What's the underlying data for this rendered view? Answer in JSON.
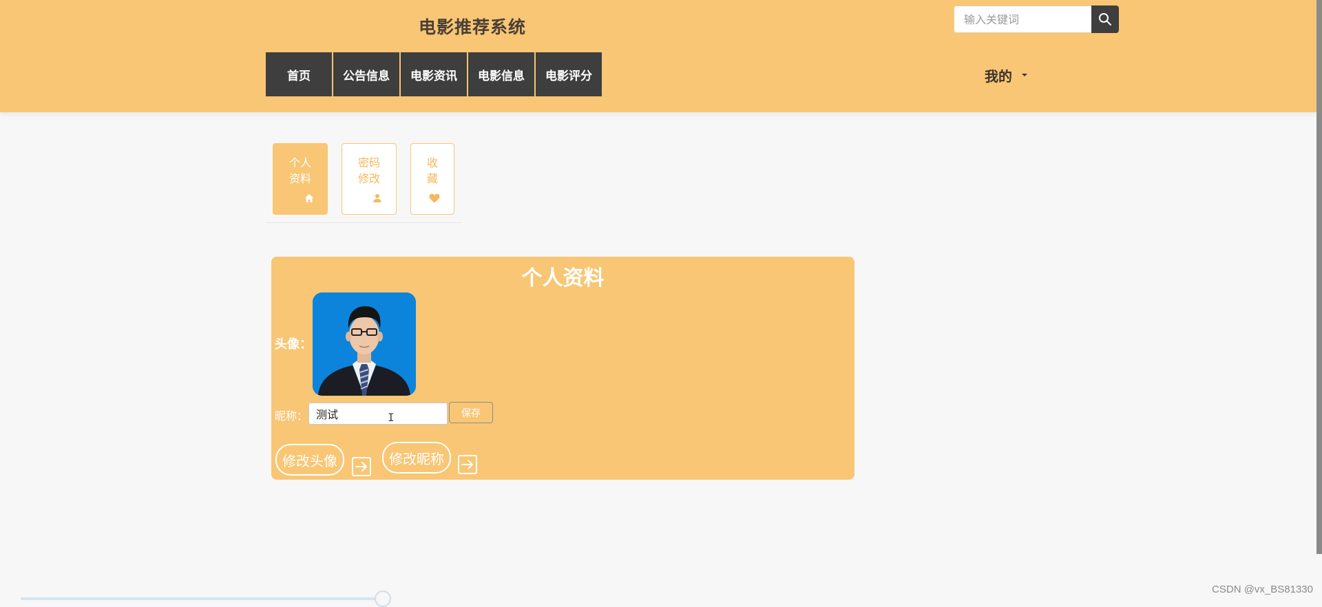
{
  "header": {
    "title": "电影推荐系统",
    "search": {
      "placeholder": "输入关键词",
      "icon": "search-icon"
    },
    "nav": [
      {
        "label": "首页"
      },
      {
        "label": "公告信息"
      },
      {
        "label": "电影资讯"
      },
      {
        "label": "电影信息"
      },
      {
        "label": "电影评分"
      }
    ],
    "user_menu": {
      "label": "我的",
      "icon": "caret-down-icon"
    }
  },
  "tabs": [
    {
      "label": "个人\n资料",
      "icon": "home-icon",
      "active": true
    },
    {
      "label": "密码\n修改",
      "icon": "user-icon",
      "active": false
    },
    {
      "label": "收\n藏",
      "icon": "heart-icon",
      "active": false
    }
  ],
  "profile": {
    "title": "个人资料",
    "avatar_label": "头像：",
    "nickname_label": "昵称：",
    "nickname_value": "测试",
    "save_label": "保存",
    "change_avatar_label": "修改头像",
    "change_nickname_label": "修改昵称",
    "arrow_icon": "arrow-right-icon"
  },
  "watermark": "CSDN @vx_BS81330",
  "colors": {
    "accent": "#f8c674",
    "nav_bg": "#3e3e3e",
    "page_bg": "#f7f7f7",
    "avatar_bg": "#0c84dc"
  }
}
